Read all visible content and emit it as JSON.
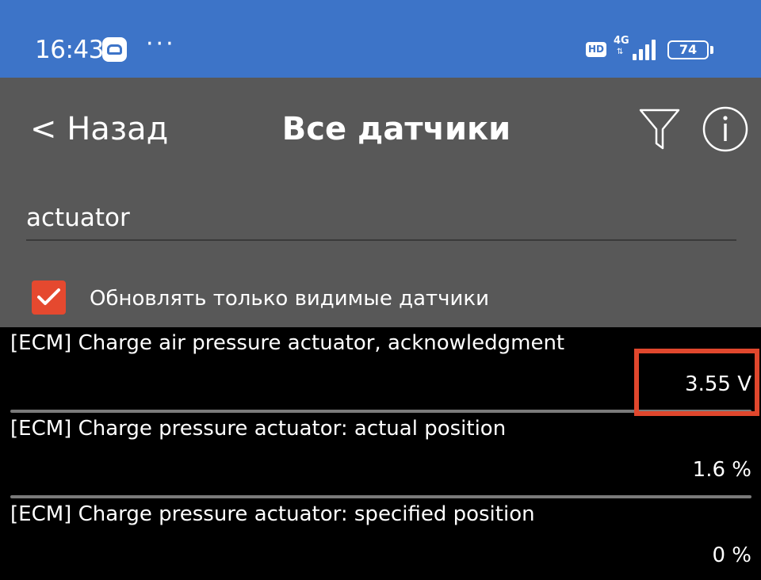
{
  "status_bar": {
    "time": "16:43",
    "more": "···",
    "hd": "HD",
    "network": "4G",
    "battery": "74",
    "signal_bars": 4,
    "color": "#3d74c8"
  },
  "header": {
    "back_label": "< Назад",
    "title": "Все датчики",
    "filter_icon": "filter-icon",
    "info_icon": "info-icon"
  },
  "search": {
    "value": "actuator"
  },
  "update_visible": {
    "checked": true,
    "label": "Обновлять только видимые датчики",
    "color": "#e5492f"
  },
  "sensors": [
    {
      "name": "[ECM] Charge air pressure actuator, acknowledgment",
      "value": "3.55 V",
      "highlighted": true
    },
    {
      "name": "[ECM] Charge pressure actuator: actual position",
      "value": "1.6 %"
    },
    {
      "name": "[ECM] Charge pressure actuator: specified position",
      "value": "0 %"
    }
  ],
  "highlight_color": "#e0472d"
}
